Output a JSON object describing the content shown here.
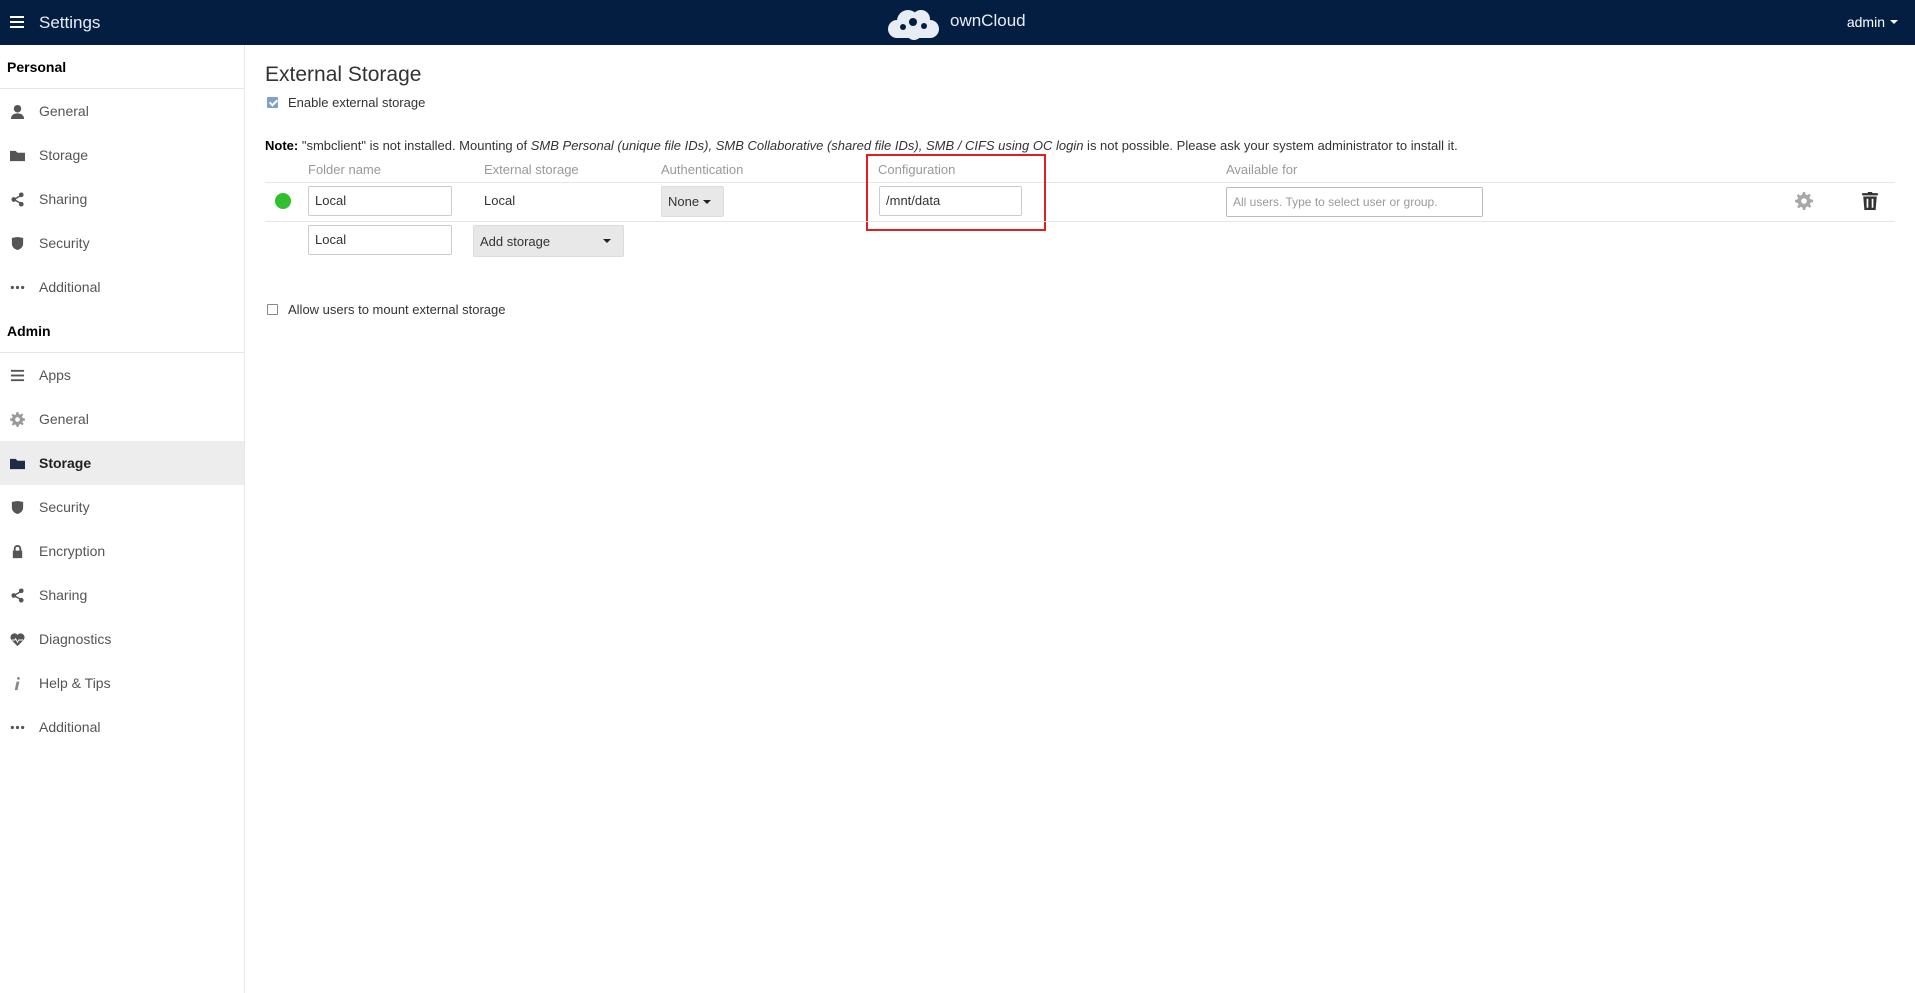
{
  "header": {
    "settings_title": "Settings",
    "brand": "ownCloud",
    "user": "admin"
  },
  "sidebar": {
    "personal_title": "Personal",
    "personal_items": [
      {
        "label": "General",
        "icon": "user-icon"
      },
      {
        "label": "Storage",
        "icon": "folder-icon"
      },
      {
        "label": "Sharing",
        "icon": "share-icon"
      },
      {
        "label": "Security",
        "icon": "shield-icon"
      },
      {
        "label": "Additional",
        "icon": "more-icon"
      }
    ],
    "admin_title": "Admin",
    "admin_items": [
      {
        "label": "Apps",
        "icon": "list-icon"
      },
      {
        "label": "General",
        "icon": "gear-icon"
      },
      {
        "label": "Storage",
        "icon": "folder-icon",
        "active": true
      },
      {
        "label": "Security",
        "icon": "shield-icon"
      },
      {
        "label": "Encryption",
        "icon": "lock-icon"
      },
      {
        "label": "Sharing",
        "icon": "share-icon"
      },
      {
        "label": "Diagnostics",
        "icon": "heartbeat-icon"
      },
      {
        "label": "Help & Tips",
        "icon": "info-icon"
      },
      {
        "label": "Additional",
        "icon": "more-icon"
      }
    ]
  },
  "main": {
    "title": "External Storage",
    "enable_label": "Enable external storage",
    "enable_checked": true,
    "note": {
      "bold": "Note:",
      "t1": " \"smbclient\" is not installed. Mounting of ",
      "i1": "SMB Personal (unique file IDs), SMB Collaborative (shared file IDs), SMB / CIFS using OC login",
      "t2": " is not possible. Please ask your system administrator to install it."
    },
    "columns": {
      "folder_name": "Folder name",
      "external_storage": "External storage",
      "authentication": "Authentication",
      "configuration": "Configuration",
      "available_for": "Available for"
    },
    "mount": {
      "status_color": "#2fbf2f",
      "folder_name": "Local",
      "external_storage": "Local",
      "authentication": "None",
      "configuration": "/mnt/data",
      "available_placeholder": "All users. Type to select user or group."
    },
    "new_row": {
      "folder_name": "Local",
      "add_storage": "Add storage"
    },
    "allow_label": "Allow users to mount external storage",
    "allow_checked": false
  }
}
